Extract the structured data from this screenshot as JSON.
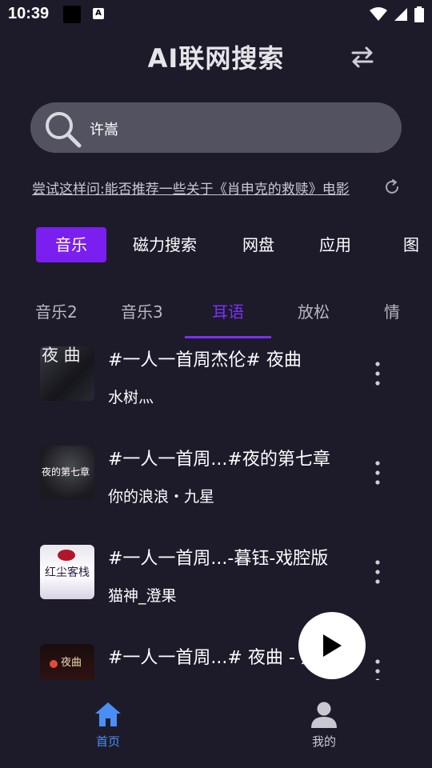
{
  "status_bar": {
    "time": "10:39",
    "a_badge": "A"
  },
  "header": {
    "title": "AI联网搜索",
    "swap_icon": "swap-arrows-icon"
  },
  "search": {
    "value": "许嵩",
    "icon": "search-icon"
  },
  "suggestion": {
    "prefix": "尝试这样问:",
    "text": "能否推荐一些关于《肖申克的救赎》电影"
  },
  "category_tabs": [
    {
      "label": "音乐",
      "active": true
    },
    {
      "label": "磁力搜索",
      "active": false
    },
    {
      "label": "网盘",
      "active": false
    },
    {
      "label": "应用",
      "active": false
    },
    {
      "label": "图",
      "active": false
    }
  ],
  "sub_tabs": [
    {
      "label": "音乐2",
      "active": false
    },
    {
      "label": "音乐3",
      "active": false
    },
    {
      "label": "耳语",
      "active": true
    },
    {
      "label": "放松",
      "active": false
    },
    {
      "label": "情",
      "active": false
    }
  ],
  "songs": [
    {
      "title": "#一人一首周杰伦# 夜曲",
      "artist": "水树灬",
      "cover_text": "夜 曲"
    },
    {
      "title": "#一人一首周...#夜的第七章",
      "artist": "你的浪浪・九星",
      "cover_text": "夜的第七章"
    },
    {
      "title": "#一人一首周...-暮钰-戏腔版",
      "artist": "猫神_澄果",
      "cover_text": "红尘客栈"
    },
    {
      "title": "#一人一首周...# 夜曲 - 人",
      "artist": "",
      "cover_text": "夜曲"
    }
  ],
  "player": {
    "play_icon": "play-icon"
  },
  "bottom_nav": [
    {
      "label": "首页",
      "icon": "home-icon",
      "active": true,
      "color": "#4a8ff5"
    },
    {
      "label": "我的",
      "icon": "user-icon",
      "active": false,
      "color": "#c9c8d2"
    }
  ],
  "colors": {
    "accent": "#7a1ff0",
    "background": "#1d1b2a",
    "search_bg": "#535260",
    "nav_active": "#4a8ff5"
  }
}
